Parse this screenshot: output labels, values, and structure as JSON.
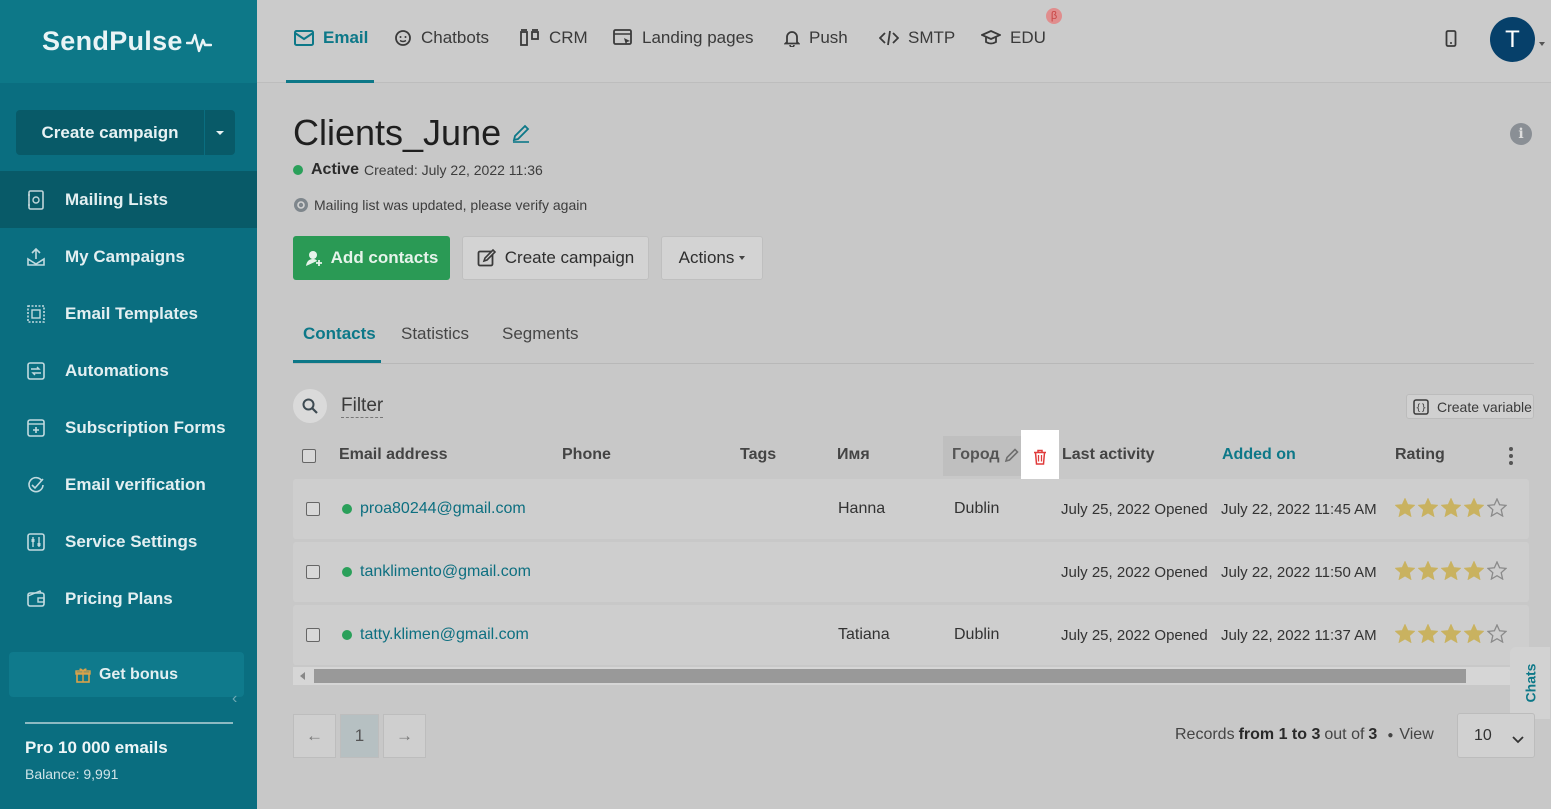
{
  "brand": {
    "name": "SendPulse"
  },
  "sidebar": {
    "create_campaign": "Create campaign",
    "items": [
      {
        "label": "Mailing Lists",
        "icon": "mailing-list-icon"
      },
      {
        "label": "My Campaigns",
        "icon": "campaigns-icon"
      },
      {
        "label": "Email Templates",
        "icon": "templates-icon"
      },
      {
        "label": "Automations",
        "icon": "automations-icon"
      },
      {
        "label": "Subscription Forms",
        "icon": "forms-icon"
      },
      {
        "label": "Email verification",
        "icon": "verification-icon"
      },
      {
        "label": "Service Settings",
        "icon": "settings-icon"
      },
      {
        "label": "Pricing Plans",
        "icon": "pricing-icon"
      }
    ],
    "bonus": "Get bonus",
    "plan": "Pro 10 000 emails",
    "balance": "Balance: 9,991"
  },
  "topnav": {
    "items": [
      {
        "label": "Email",
        "icon": "envelope-icon"
      },
      {
        "label": "Chatbots",
        "icon": "chatbot-icon"
      },
      {
        "label": "CRM",
        "icon": "crm-icon"
      },
      {
        "label": "Landing pages",
        "icon": "landing-icon"
      },
      {
        "label": "Push",
        "icon": "bell-icon"
      },
      {
        "label": "SMTP",
        "icon": "code-icon"
      },
      {
        "label": "EDU",
        "icon": "graduation-cap-icon"
      }
    ],
    "beta_badge": "β",
    "avatar_initial": "T"
  },
  "list": {
    "title": "Clients_June",
    "status": "Active",
    "created": "Created: July 22, 2022 11:36",
    "notice": "Mailing list was updated, please verify again"
  },
  "buttons": {
    "add_contacts": "Add contacts",
    "create_campaign": "Create campaign",
    "actions": "Actions"
  },
  "tabs": [
    "Contacts",
    "Statistics",
    "Segments"
  ],
  "toolbar": {
    "filter": "Filter",
    "create_variable": "Create variable"
  },
  "table": {
    "columns": [
      "Email address",
      "Phone",
      "Tags",
      "Имя",
      "Город",
      "Last activity",
      "Added on",
      "Rating"
    ],
    "rows": [
      {
        "email": "proa80244@gmail.com",
        "phone": "",
        "tags": "",
        "name": "Hanna",
        "city": "Dublin",
        "last_activity": "July 25, 2022 Opened",
        "added_on": "July 22, 2022 11:45 AM",
        "rating": 4
      },
      {
        "email": "tanklimento@gmail.com",
        "phone": "",
        "tags": "",
        "name": "",
        "city": "",
        "last_activity": "July 25, 2022 Opened",
        "added_on": "July 22, 2022 11:50 AM",
        "rating": 4
      },
      {
        "email": "tatty.klimen@gmail.com",
        "phone": "",
        "tags": "",
        "name": "Tatiana",
        "city": "Dublin",
        "last_activity": "July 25, 2022 Opened",
        "added_on": "July 22, 2022 11:37 AM",
        "rating": 4
      }
    ],
    "rating_max": 5
  },
  "pagination": {
    "prev": "←",
    "current": "1",
    "next": "→",
    "records_prefix": "Records",
    "records_range": "from 1 to 3",
    "records_out_of": "out of",
    "records_total": "3",
    "view_label": "View",
    "view_value": "10"
  },
  "chats": "Chats",
  "colors": {
    "accent": "#0d7888",
    "success": "#2a9a55",
    "danger": "#e03c3c",
    "star": "#c9b260"
  }
}
